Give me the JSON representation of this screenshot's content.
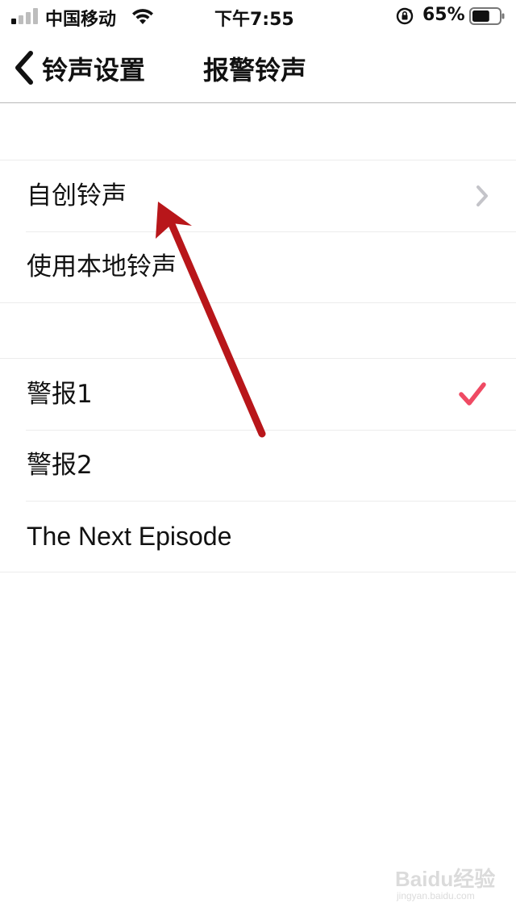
{
  "status_bar": {
    "carrier": "中国移动",
    "time": "下午7:55",
    "battery_percent": "65%",
    "battery_level": 0.65,
    "signal_bars_filled": 1,
    "signal_bars_total": 4
  },
  "nav": {
    "back_label": "铃声设置",
    "title": "报警铃声"
  },
  "group1": {
    "items": [
      {
        "label": "自创铃声",
        "accessory": "chevron-right-icon"
      },
      {
        "label": "使用本地铃声",
        "accessory": ""
      }
    ]
  },
  "group2": {
    "items": [
      {
        "label": "警报1",
        "accessory": "checkmark-icon"
      },
      {
        "label": "警报2",
        "accessory": ""
      },
      {
        "label": "The Next Episode",
        "accessory": ""
      }
    ]
  },
  "colors": {
    "checkmark": "#ef4a63",
    "chevron": "#c4c4c9",
    "annotation_arrow": "#b8161a",
    "separator": "#ececec"
  },
  "watermark": {
    "main": "Baidu经验",
    "sub": "jingyan.baidu.com"
  }
}
